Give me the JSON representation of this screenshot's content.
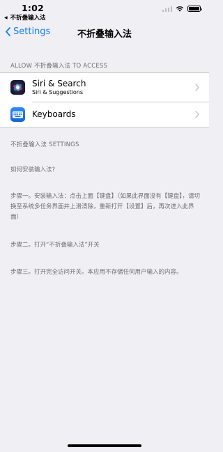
{
  "status_bar": {
    "time": "1:02",
    "back_app": "不折叠输入法"
  },
  "nav": {
    "back_label": "Settings",
    "title": "不折叠输入法"
  },
  "allow_section": {
    "header": "ALLOW 不折叠输入法 TO ACCESS",
    "items": [
      {
        "title": "Siri & Search",
        "subtitle": "Siri & Suggestions",
        "icon": "siri-icon"
      },
      {
        "title": "Keyboards",
        "icon": "keyboard-icon"
      }
    ]
  },
  "settings_section": {
    "header": "不折叠输入法 SETTINGS",
    "paragraphs": [
      "如何安装输入法?",
      "步骤一。安装输入法：点击上面【键盘】（如果此界面没有【键盘】，请切换至系统多任务界面并上滑清除，重新打开【设置】后，再次进入此界面）",
      "步骤二。打开“不折叠输入法”开关",
      "步骤三。打开完全访问开关。本应用不存储任何用户输入的内容。"
    ]
  },
  "colors": {
    "background": "#efeff4",
    "accent": "#147efb",
    "secondary_text": "#6d6d72"
  }
}
